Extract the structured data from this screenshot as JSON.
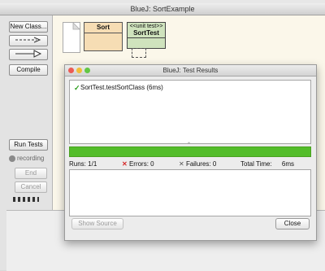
{
  "window": {
    "title": "BlueJ:  SortExample"
  },
  "toolbar": {
    "new_class": "New Class...",
    "compile": "Compile",
    "run_tests": "Run Tests",
    "recording": "recording",
    "end": "End",
    "cancel": "Cancel"
  },
  "diagram": {
    "sort_class": "Sort",
    "test_stereotype": "<<unit test>>",
    "test_class": "SortTest"
  },
  "dialog": {
    "title": "BlueJ:  Test Results",
    "result_item": "SortTest.testSortClass (6ms)",
    "runs_label": "Runs:",
    "runs_value": "1/1",
    "errors_label": "Errors:",
    "errors_value": "0",
    "failures_label": "Failures:",
    "failures_value": "0",
    "time_label": "Total Time:",
    "time_value": "6ms",
    "show_source": "Show Source",
    "close": "Close"
  },
  "colors": {
    "progress_pass": "#53bd2a",
    "test_class_fill": "#cfe3bd",
    "class_fill": "#f6ddb4",
    "canvas_bg": "#fbf7ea"
  },
  "icons": {
    "result_status": "green-check-icon",
    "errors": "red-x-icon",
    "failures": "gray-x-icon",
    "record": "record-dot-icon"
  }
}
